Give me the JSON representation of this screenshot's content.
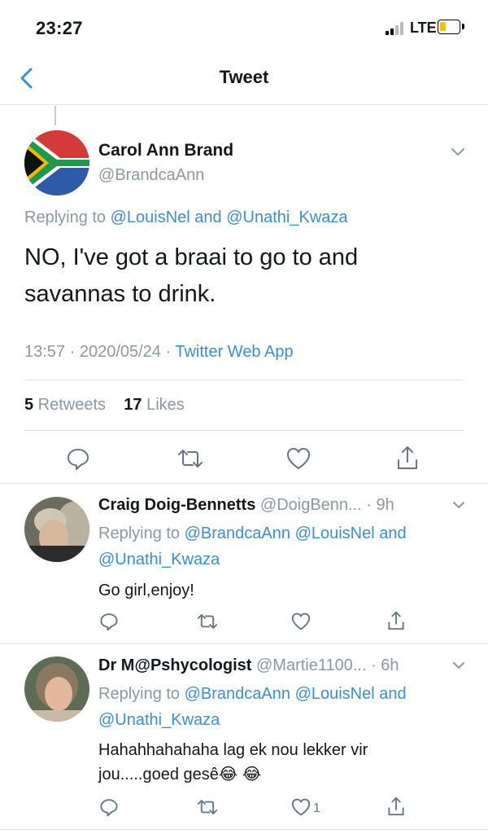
{
  "status_bar": {
    "time": "23:27",
    "network": "LTE"
  },
  "nav": {
    "title": "Tweet"
  },
  "main_tweet": {
    "name": "Carol Ann Brand",
    "handle": "@BrandcaAnn",
    "replying_prefix": "Replying to ",
    "replying_user1": "@LouisNel",
    "replying_and": " and ",
    "replying_user2": "@Unathi_Kwaza",
    "text_line1": "NO, I've got a braai to go to and",
    "text_line2": "savannas to drink.",
    "time": "13:57 · 2020/05/24 · ",
    "source": "Twitter Web App",
    "retweets_count": "5",
    "retweets_label": " Retweets",
    "likes_count": "17",
    "likes_label": " Likes"
  },
  "replies": [
    {
      "name": "Craig Doig-Bennetts",
      "handle": "@DoigBenn...",
      "age": " · 9h",
      "replying_prefix": "Replying to ",
      "replying_users_line1": "@BrandcaAnn @LouisNel",
      "replying_and": " and",
      "replying_users_line2": "@Unathi_Kwaza",
      "text_line1": "Go girl,enjoy!",
      "like_count": ""
    },
    {
      "name": "Dr M@Pshycologist",
      "handle": "@Martie1100...",
      "age": " · 6h",
      "replying_prefix": "Replying to ",
      "replying_users_line1": "@BrandcaAnn @LouisNel",
      "replying_and": " and",
      "replying_users_line2": "@Unathi_Kwaza",
      "text_line1": "Hahahhahahaha lag ek nou lekker vir",
      "text_line2": "jou.....goed gesê😂 😂",
      "like_count": "1"
    }
  ],
  "colors": {
    "accent": "#3a8fd0",
    "secondary_text": "#8b98a5",
    "divider": "#dfe3e6",
    "battery": "#f7c300"
  },
  "icons": [
    "back-icon",
    "chevron-down-icon",
    "reply-icon",
    "retweet-icon",
    "like-icon",
    "share-icon",
    "signal-icon",
    "battery-icon"
  ]
}
